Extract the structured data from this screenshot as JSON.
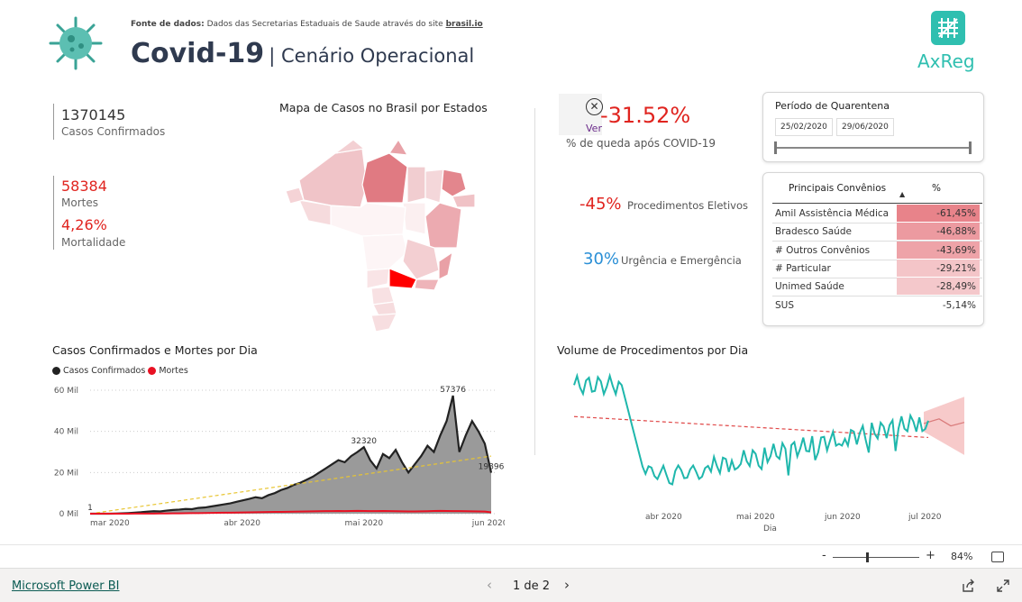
{
  "header": {
    "source_label": "Fonte de dados:",
    "source_text": "Dados das Secretarias Estaduais de Saude através do site",
    "source_link": "brasil.io",
    "title": "Covid-19",
    "subtitle": "| Cenário Operacional",
    "brand": "AxReg"
  },
  "kpis": {
    "confirmed_value": "1370145",
    "confirmed_label": "Casos Confirmados",
    "deaths_value": "58384",
    "deaths_label": "Mortes",
    "mortality_value": "4,26%",
    "mortality_label": "Mortalidade"
  },
  "map": {
    "title": "Mapa de Casos no Brasil por Estados"
  },
  "drop": {
    "visual_text": "Ver",
    "value": "-31.52%",
    "label": "% de queda após COVID-19"
  },
  "procedures": {
    "elective_value": "-45%",
    "elective_label": "Procedimentos Eletivos",
    "urgency_value": "30%",
    "urgency_label": "Urgência e Emergência"
  },
  "quarantine": {
    "title": "Período de Quarentena",
    "start": "25/02/2020",
    "end": "29/06/2020"
  },
  "convenios": {
    "col_name": "Principais Convênios",
    "col_pct": "%",
    "rows": [
      {
        "name": "Amil Assistência Médica",
        "pct": "-61,45%",
        "shade": "#e8838a"
      },
      {
        "name": "Bradesco Saúde",
        "pct": "-46,88%",
        "shade": "#ec9aa0"
      },
      {
        "name": "# Outros Convênios",
        "pct": "-43,69%",
        "shade": "#eea3a8"
      },
      {
        "name": "# Particular",
        "pct": "-29,21%",
        "shade": "#f4c5c8"
      },
      {
        "name": "Unimed Saúde",
        "pct": "-28,49%",
        "shade": "#f4c8cb"
      },
      {
        "name": "SUS",
        "pct": "-5,14%",
        "shade": "#ffffff"
      }
    ]
  },
  "chart_data": [
    {
      "type": "area",
      "title": "Casos Confirmados e Mortes por Dia",
      "legend": [
        "Casos Confirmados",
        "Mortes"
      ],
      "legend_position": "top-left",
      "series_colors": {
        "Casos Confirmados": "#222222",
        "Mortes": "#e81123"
      },
      "y_ticks": [
        "60 Mil",
        "40 Mil",
        "20 Mil",
        "0 Mil"
      ],
      "ylim": [
        0,
        60000
      ],
      "x_ticks": [
        "mar 2020",
        "abr 2020",
        "mai 2020",
        "jun 2020"
      ],
      "grid": true,
      "cases": [
        1,
        0,
        0,
        0,
        50,
        150,
        300,
        500,
        700,
        1000,
        1200,
        1100,
        1500,
        1800,
        2000,
        2300,
        2200,
        2800,
        3000,
        3500,
        4000,
        4500,
        5000,
        5800,
        6500,
        7200,
        8000,
        7500,
        9000,
        10000,
        11500,
        12500,
        14000,
        15000,
        16500,
        18000,
        20000,
        22000,
        24000,
        26000,
        25000,
        28000,
        30000,
        32320,
        26000,
        22000,
        29000,
        27000,
        31000,
        25000,
        20000,
        24000,
        28000,
        33000,
        30000,
        38000,
        45000,
        57376,
        30000,
        38000,
        45000,
        40000,
        34000,
        19896
      ],
      "deaths": [
        0,
        0,
        0,
        0,
        5,
        10,
        20,
        30,
        40,
        60,
        80,
        100,
        120,
        150,
        180,
        200,
        250,
        300,
        350,
        380,
        420,
        480,
        520,
        560,
        600,
        650,
        700,
        750,
        800,
        850,
        900,
        950,
        1000,
        1050,
        1100,
        1148,
        1200,
        1250,
        1269,
        1300,
        1250,
        1300,
        1350,
        1300,
        1280,
        1250,
        1300,
        1280,
        1200,
        1150,
        1100,
        1100,
        1150,
        1200,
        1300,
        1350,
        1300,
        1250,
        1269,
        1200,
        1150,
        1100,
        1050,
        653
      ],
      "data_labels": [
        {
          "text": "1",
          "index": 0,
          "value": 1
        },
        {
          "text": "32320",
          "index": 43,
          "value": 32320
        },
        {
          "text": "57376",
          "index": 57,
          "value": 57376
        },
        {
          "text": "19896",
          "index": 63,
          "value": 19896
        }
      ]
    },
    {
      "type": "line",
      "title": "Volume de Procedimentos por Dia",
      "xlabel": "Dia",
      "x_ticks": [
        "abr 2020",
        "mai 2020",
        "jun 2020",
        "jul 2020"
      ],
      "series_colors": {
        "Procedimentos": "#1fb7ac",
        "Tendência": "#e04848",
        "Previsão": "#f4b3b3"
      },
      "trend_color": "#e04848",
      "forecast_color": "#f4b3b3"
    }
  ],
  "status": {
    "zoom_minus": "-",
    "zoom_plus": "+",
    "zoom": "84%",
    "app_link": "Microsoft Power BI",
    "page_indicator": "1 de 2"
  }
}
